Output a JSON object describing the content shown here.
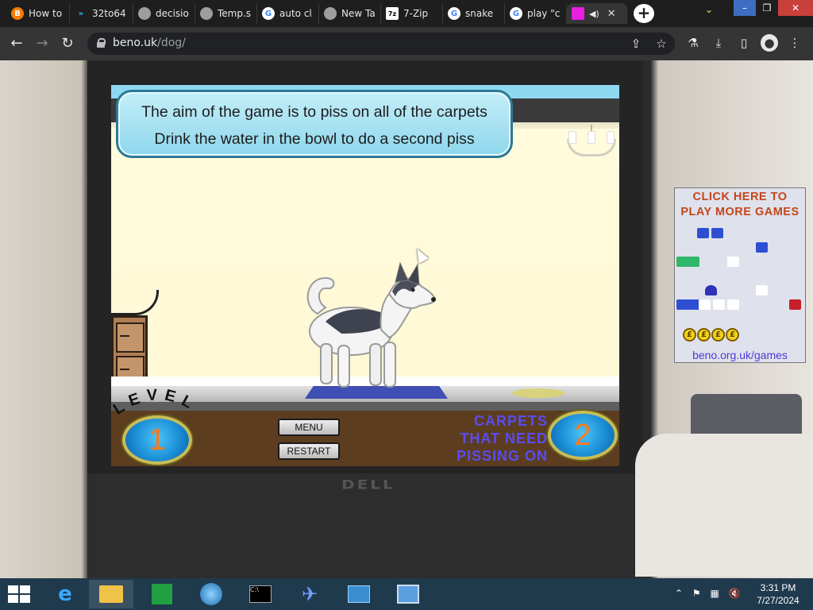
{
  "browser": {
    "tabs": [
      {
        "title": "How to",
        "favicon": "blogger-icon",
        "color": "#f57c00"
      },
      {
        "title": "32to64",
        "favicon": "chevron-app-icon",
        "color": "#29b6f6"
      },
      {
        "title": "decisio",
        "favicon": "globe-icon",
        "color": "#9e9e9e"
      },
      {
        "title": "Temp.s",
        "favicon": "globe-icon",
        "color": "#9e9e9e"
      },
      {
        "title": "auto cl",
        "favicon": "google-icon",
        "color": "#4285f4"
      },
      {
        "title": "New Ta",
        "favicon": "chrome-icon",
        "color": "#9e9e9e"
      },
      {
        "title": "7-Zip",
        "favicon": "7zip-icon",
        "color": "#ffffff"
      },
      {
        "title": "snake",
        "favicon": "google-icon",
        "color": "#4285f4"
      },
      {
        "title": "play \"c",
        "favicon": "google-icon",
        "color": "#4285f4"
      },
      {
        "title": "",
        "favicon": "beno-icon",
        "color": "#e91ee0"
      }
    ],
    "url_host": "beno.uk",
    "url_path": "/dog/"
  },
  "game": {
    "instructions": [
      "The aim of the game is to piss on all of the carpets",
      "Drink the water in the bowl to do a second piss"
    ],
    "level_label": "LEVEL",
    "level": "1",
    "carpets_label_lines": [
      "CARPETS",
      "THAT NEED",
      "PISSING ON"
    ],
    "carpets_remaining": "2",
    "menu_button": "MENU",
    "restart_button": "RESTART"
  },
  "ad": {
    "title_lines": [
      "CLICK HERE TO",
      "PLAY MORE GAMES"
    ],
    "url": "beno.org.uk/games",
    "coin_symbol": "£"
  },
  "taskbar": {
    "time": "3:31 PM",
    "date": "7/27/2024"
  }
}
